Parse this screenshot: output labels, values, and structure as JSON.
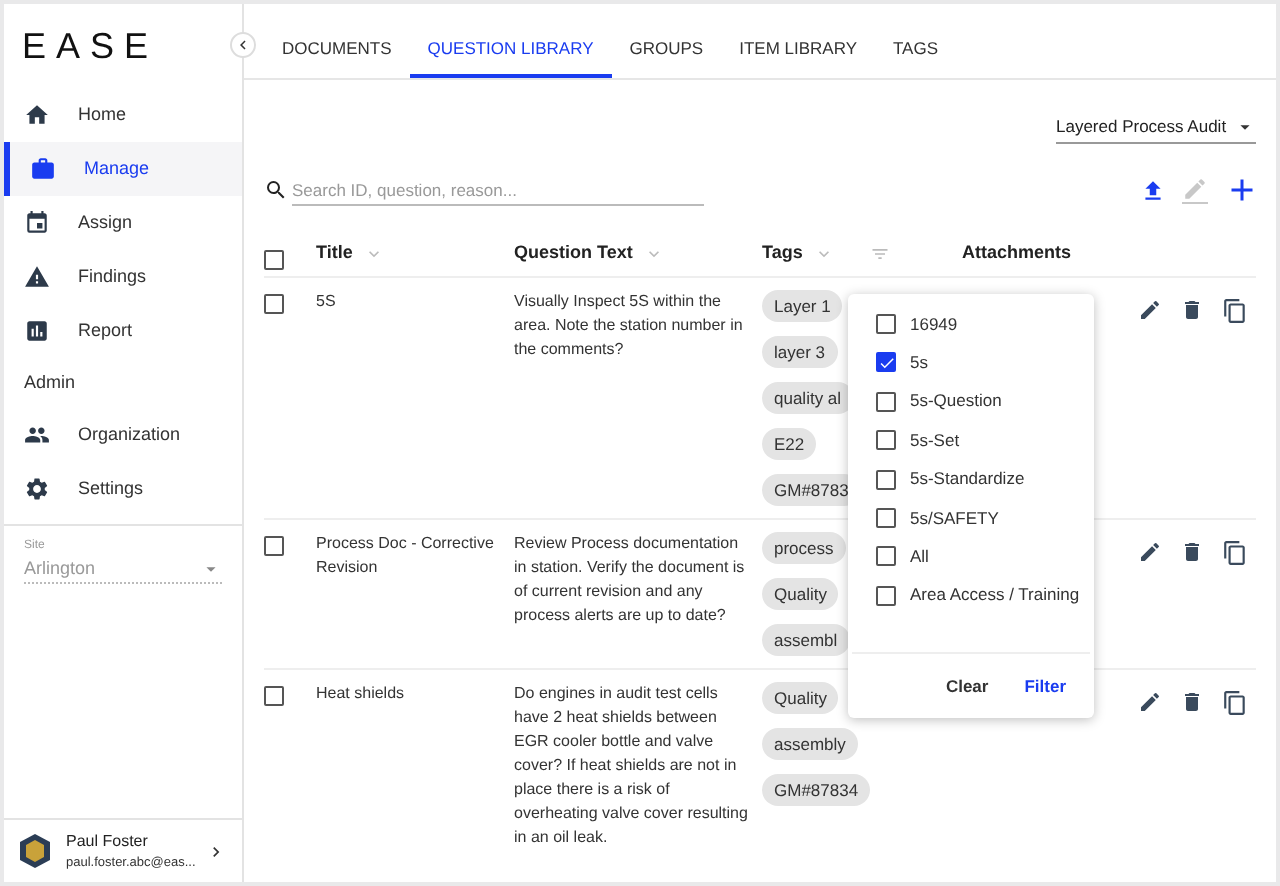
{
  "sidebar": {
    "logo": "EASE",
    "items": [
      {
        "kind": "home",
        "label": "Home",
        "selected": false
      },
      {
        "kind": "manage",
        "label": "Manage",
        "selected": true
      },
      {
        "kind": "assign",
        "label": "Assign",
        "selected": false
      },
      {
        "kind": "findings",
        "label": "Findings",
        "selected": false
      },
      {
        "kind": "report",
        "label": "Report",
        "selected": false
      }
    ],
    "section": "Admin",
    "admin_items": [
      {
        "kind": "organization",
        "label": "Organization",
        "selected": false
      },
      {
        "kind": "settings",
        "label": "Settings",
        "selected": false
      }
    ],
    "site": {
      "label": "Site",
      "value": "Arlington"
    },
    "user": {
      "name": "Paul Foster",
      "email": "paul.foster.abc@eas..."
    }
  },
  "tabs": [
    {
      "label": "DOCUMENTS",
      "selected": false
    },
    {
      "label": "QUESTION LIBRARY",
      "selected": true
    },
    {
      "label": "GROUPS",
      "selected": false
    },
    {
      "label": "ITEM LIBRARY",
      "selected": false
    },
    {
      "label": "TAGS",
      "selected": false
    }
  ],
  "audit_type": "Layered Process Audit",
  "search": {
    "placeholder": "Search ID, question, reason..."
  },
  "toolbar": [
    {
      "kind": "upload",
      "disabled": false
    },
    {
      "kind": "edit",
      "disabled": true
    },
    {
      "kind": "add",
      "disabled": false
    }
  ],
  "table": {
    "select_all": false,
    "columns": [
      "Title",
      "Question Text",
      "Tags",
      "Attachments"
    ],
    "rows": [
      {
        "checked": false,
        "title": "5S",
        "question": "Visually Inspect 5S within the area. Note the station number in the comments?",
        "tags": [
          "Layer 1",
          "layer 3",
          "quality al",
          "E22",
          "GM#8783"
        ]
      },
      {
        "checked": false,
        "title": "Process Doc - Corrective Revision",
        "question": "Review Process documentation in station. Verify the document is of current revision and any process alerts are up to date?",
        "tags": [
          "process",
          "Quality",
          "assembl"
        ]
      },
      {
        "checked": false,
        "title": "Heat shields",
        "question": "Do engines in audit test cells have 2 heat shields between EGR cooler bottle and valve cover? If heat shields are not in place there is a risk of overheating valve cover resulting in an oil leak.",
        "tags": [
          "Quality",
          "assembly",
          "GM#87834"
        ]
      }
    ]
  },
  "tag_filter": {
    "options": [
      {
        "label": "16949",
        "checked": false
      },
      {
        "label": "5s",
        "checked": true
      },
      {
        "label": "5s-Question",
        "checked": false
      },
      {
        "label": "5s-Set",
        "checked": false
      },
      {
        "label": "5s-Standardize",
        "checked": false
      },
      {
        "label": "5s/SAFETY",
        "checked": false
      },
      {
        "label": "All",
        "checked": false
      },
      {
        "label": "Area Access / Training",
        "checked": false
      }
    ],
    "buttons": [
      {
        "kind": "clear",
        "label": "Clear"
      },
      {
        "kind": "filter",
        "label": "Filter"
      }
    ]
  }
}
